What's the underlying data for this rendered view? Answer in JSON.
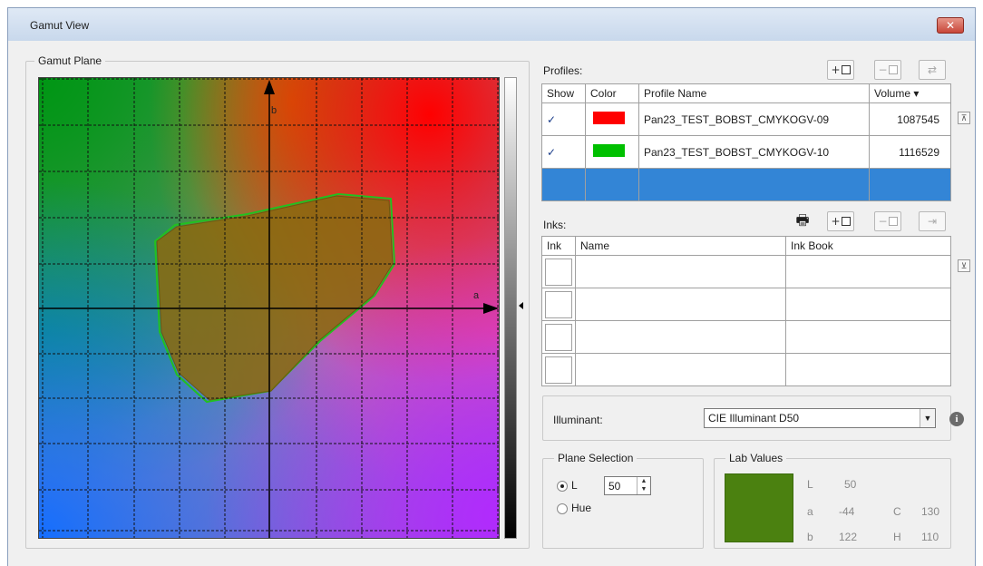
{
  "window": {
    "title": "Gamut View",
    "close_label": "✕"
  },
  "gamut_plane": {
    "group_label": "Gamut Plane",
    "axis_a": "a",
    "axis_b": "b"
  },
  "profiles": {
    "label": "Profiles:",
    "buttons": {
      "add": "+",
      "remove": "−",
      "edit": "⇄"
    },
    "columns": {
      "show": "Show",
      "color": "Color",
      "name": "Profile Name",
      "volume": "Volume ▾"
    },
    "rows": [
      {
        "show": "✓",
        "color": "#ff0000",
        "name": "Pan23_TEST_BOBST_CMYKOGV-09",
        "volume": "1087545"
      },
      {
        "show": "✓",
        "color": "#00c000",
        "name": "Pan23_TEST_BOBST_CMYKOGV-10",
        "volume": "1116529"
      }
    ]
  },
  "inks": {
    "label": "Inks:",
    "columns": {
      "ink": "Ink",
      "name": "Name",
      "book": "Ink Book"
    },
    "buttons": {
      "add": "+",
      "remove": "−",
      "import": "⇥"
    }
  },
  "illuminant": {
    "label": "Illuminant:",
    "value": "CIE Illuminant D50",
    "arrow": "▼",
    "info": "i"
  },
  "plane_selection": {
    "group_label": "Plane Selection",
    "option_l": "L",
    "option_hue": "Hue",
    "l_value": "50",
    "selected": "L"
  },
  "lab_values": {
    "group_label": "Lab Values",
    "swatch_color": "#4b8110",
    "L_label": "L",
    "L": "50",
    "a_label": "a",
    "a": "-44",
    "b_label": "b",
    "b": "122",
    "C_label": "C",
    "C": "130",
    "H_label": "H",
    "H": "110"
  }
}
